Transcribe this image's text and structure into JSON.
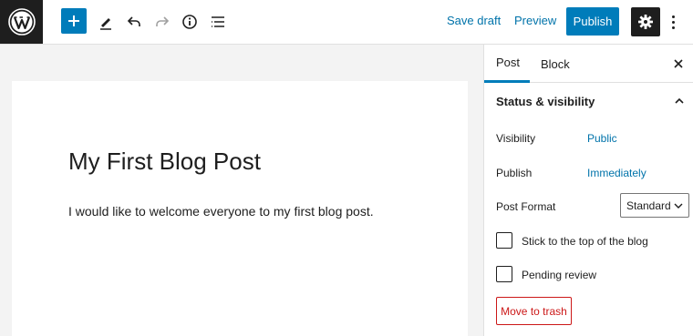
{
  "toolbar": {
    "save_draft_label": "Save draft",
    "preview_label": "Preview",
    "publish_label": "Publish"
  },
  "editor": {
    "title": "My First Blog Post",
    "paragraph": "I would like to welcome everyone to my first blog post."
  },
  "sidebar": {
    "tabs": [
      {
        "label": "Post",
        "active": true
      },
      {
        "label": "Block",
        "active": false
      }
    ],
    "panel_title": "Status & visibility",
    "visibility_label": "Visibility",
    "visibility_value": "Public",
    "publish_label": "Publish",
    "publish_value": "Immediately",
    "post_format_label": "Post Format",
    "post_format_value": "Standard",
    "sticky_label": "Stick to the top of the blog",
    "pending_label": "Pending review",
    "trash_label": "Move to trash"
  },
  "colors": {
    "accent": "#007cba",
    "link": "#0073aa",
    "danger": "#cc1818",
    "dark": "#1e1e1e"
  },
  "icons": [
    "wordpress-logo-icon",
    "plus-icon",
    "pencil-icon",
    "undo-icon",
    "redo-icon",
    "info-icon",
    "list-view-icon",
    "gear-icon",
    "more-vertical-icon",
    "close-icon",
    "chevron-up-icon",
    "chevron-down-icon"
  ]
}
